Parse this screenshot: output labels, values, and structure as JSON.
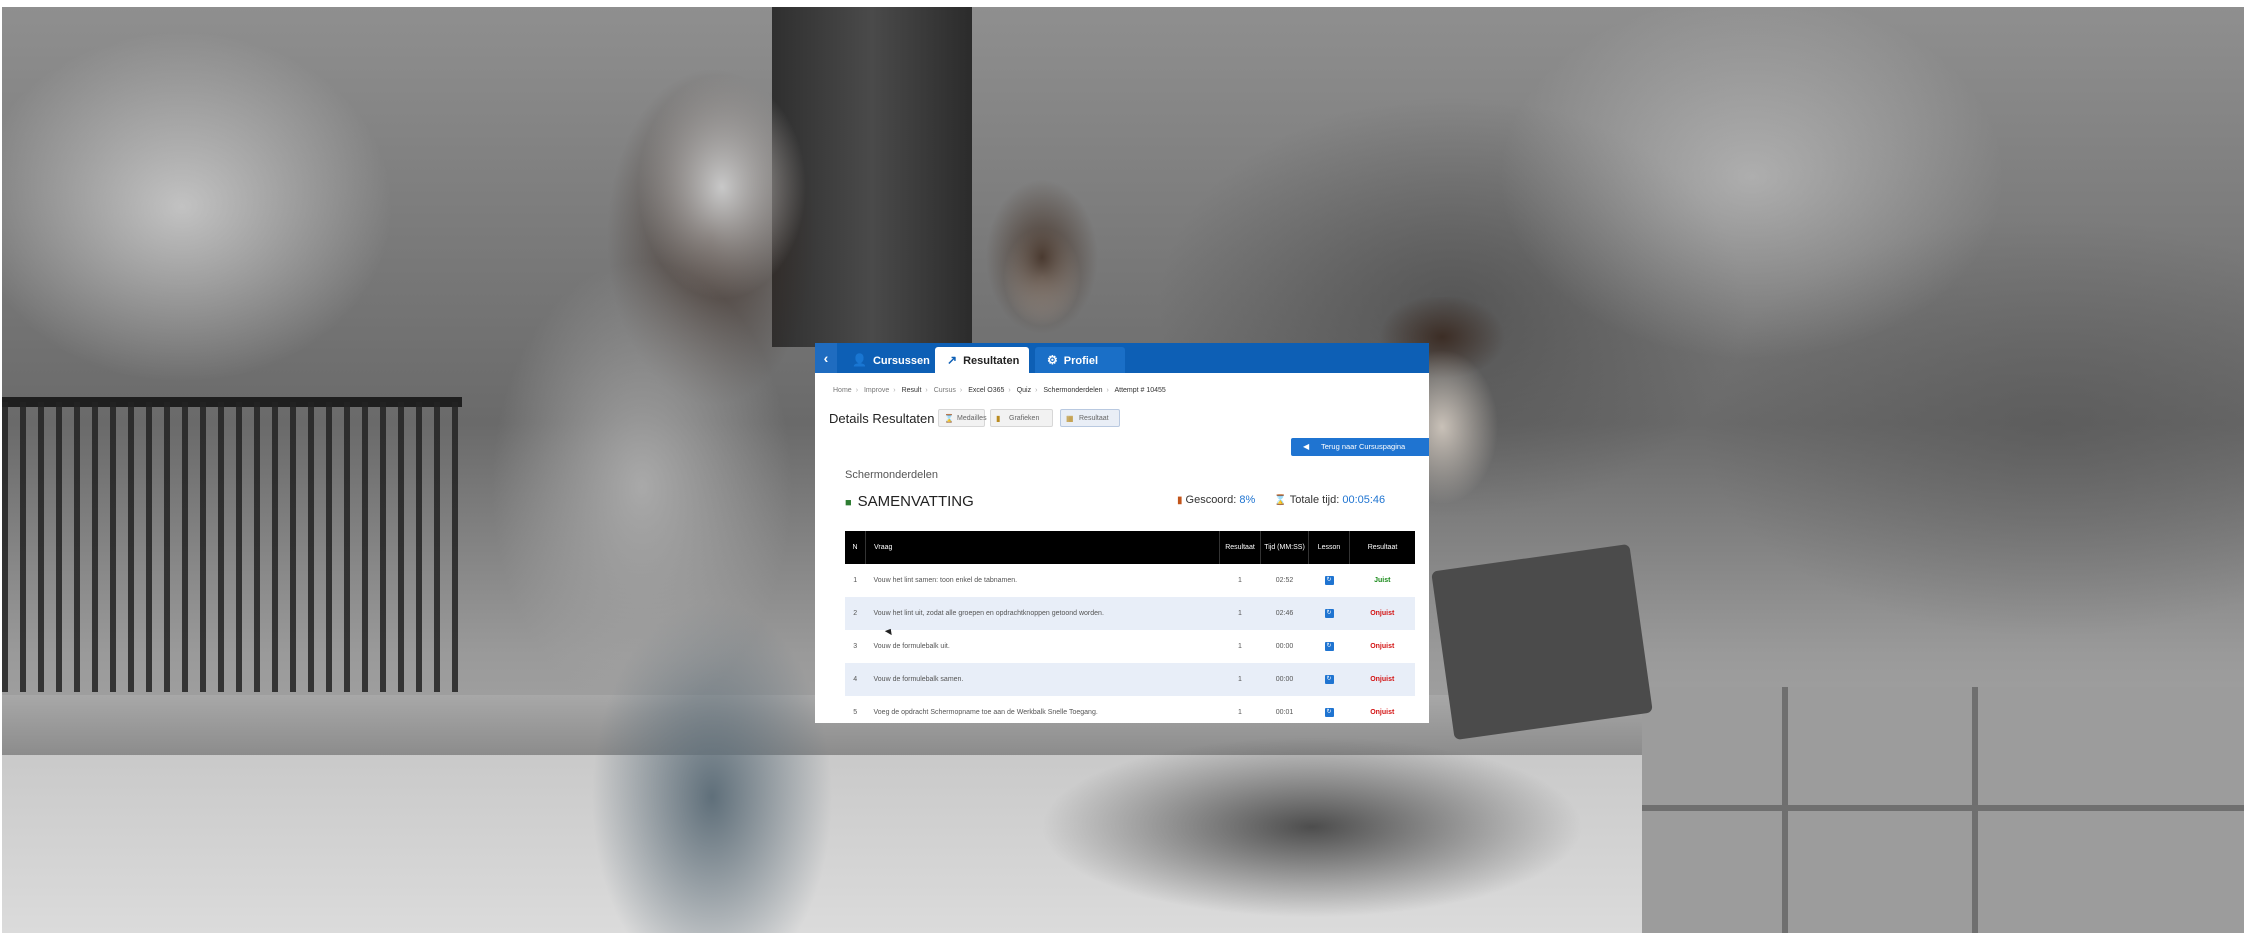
{
  "nav": {
    "back": "‹",
    "tabs": [
      {
        "label": "Cursussen",
        "icon": "user-icon"
      },
      {
        "label": "Resultaten",
        "icon": "chart-line-icon"
      },
      {
        "label": "Profiel",
        "icon": "gear-icon"
      }
    ]
  },
  "breadcrumb": [
    "Home",
    "Improve",
    "Result",
    "Cursus",
    "Excel O365",
    "Quiz",
    "Schermonderdelen",
    "Attempt # 10455"
  ],
  "details": {
    "title": "Details Resultaten",
    "pills": [
      "Medailles",
      "Grafieken",
      "Resultaat"
    ]
  },
  "back_button": "Terug naar Cursuspagina",
  "section_name": "Schermonderdelen",
  "summary_title": "SAMENVATTING",
  "stats": {
    "score_label": "Gescoord:",
    "score_value": "8%",
    "time_label": "Totale tijd:",
    "time_value": "00:05:46"
  },
  "table": {
    "headers": [
      "N",
      "Vraag",
      "Resultaat",
      "Tijd (MM:SS)",
      "Lesson",
      "Resultaat"
    ],
    "rows": [
      {
        "n": "1",
        "vraag": "Vouw het lint samen: toon enkel de tabnamen.",
        "resultaat": "1",
        "tijd": "02:52",
        "status": "Juist"
      },
      {
        "n": "2",
        "vraag": "Vouw het lint uit, zodat alle groepen en opdrachtknoppen getoond worden.",
        "resultaat": "1",
        "tijd": "02:46",
        "status": "Onjuist"
      },
      {
        "n": "3",
        "vraag": "Vouw de formulebalk uit.",
        "resultaat": "1",
        "tijd": "00:00",
        "status": "Onjuist"
      },
      {
        "n": "4",
        "vraag": "Vouw de formulebalk samen.",
        "resultaat": "1",
        "tijd": "00:00",
        "status": "Onjuist"
      },
      {
        "n": "5",
        "vraag": "Voeg de opdracht Schermopname toe aan de Werkbalk Snelle Toegang.",
        "resultaat": "1",
        "tijd": "00:01",
        "status": "Onjuist"
      }
    ]
  },
  "colors": {
    "accent": "#0d5fb5",
    "correct": "#1a8a1a",
    "wrong": "#d31212"
  }
}
